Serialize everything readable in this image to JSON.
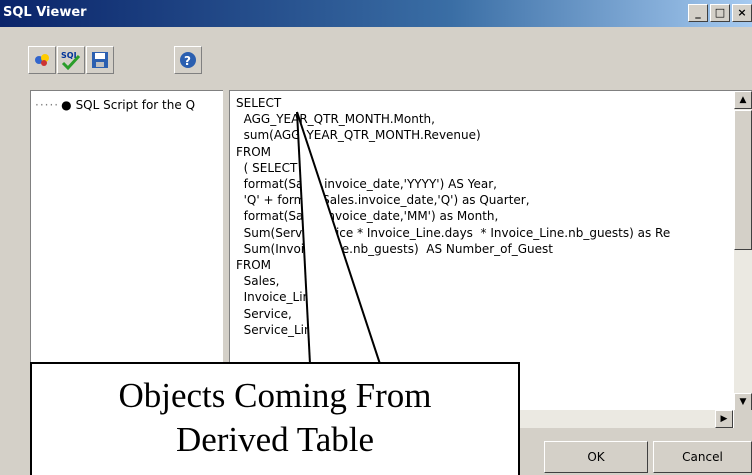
{
  "window": {
    "title": "SQL Viewer",
    "minimize": "_",
    "maximize": "□",
    "close": "×"
  },
  "toolbar": {
    "buttons": [
      "properties-icon",
      "check-sql-icon",
      "save-icon",
      "help-icon"
    ],
    "sql_label": "SQL"
  },
  "tree": {
    "item_label": "SQL Script for the Q"
  },
  "sql": {
    "text": "SELECT\n  AGG_YEAR_QTR_MONTH.Month,\n  sum(AGG_YEAR_QTR_MONTH.Revenue)\nFROM\n  ( SELECT\n  format(Sales.invoice_date,'YYYY') AS Year,\n  'Q' + format(Sales.invoice_date,'Q') as Quarter,\n  format(Sales.invoice_date,'MM') as Month,\n  Sum(Service.price * Invoice_Line.days  * Invoice_Line.nb_guests) as Re\n  Sum(Invoice_Line.nb_guests)  AS Number_of_Guest\nFROM\n  Sales,\n  Invoice_Line,\n  Service,\n  Service_Line"
  },
  "buttons": {
    "ok": "OK",
    "cancel": "Cancel"
  },
  "callout": {
    "line1": "Objects Coming From",
    "line2": "Derived Table"
  },
  "colors": {
    "titlebar_start": "#0a246a",
    "titlebar_end": "#a6caf0",
    "window_bg": "#d4d0c8"
  }
}
